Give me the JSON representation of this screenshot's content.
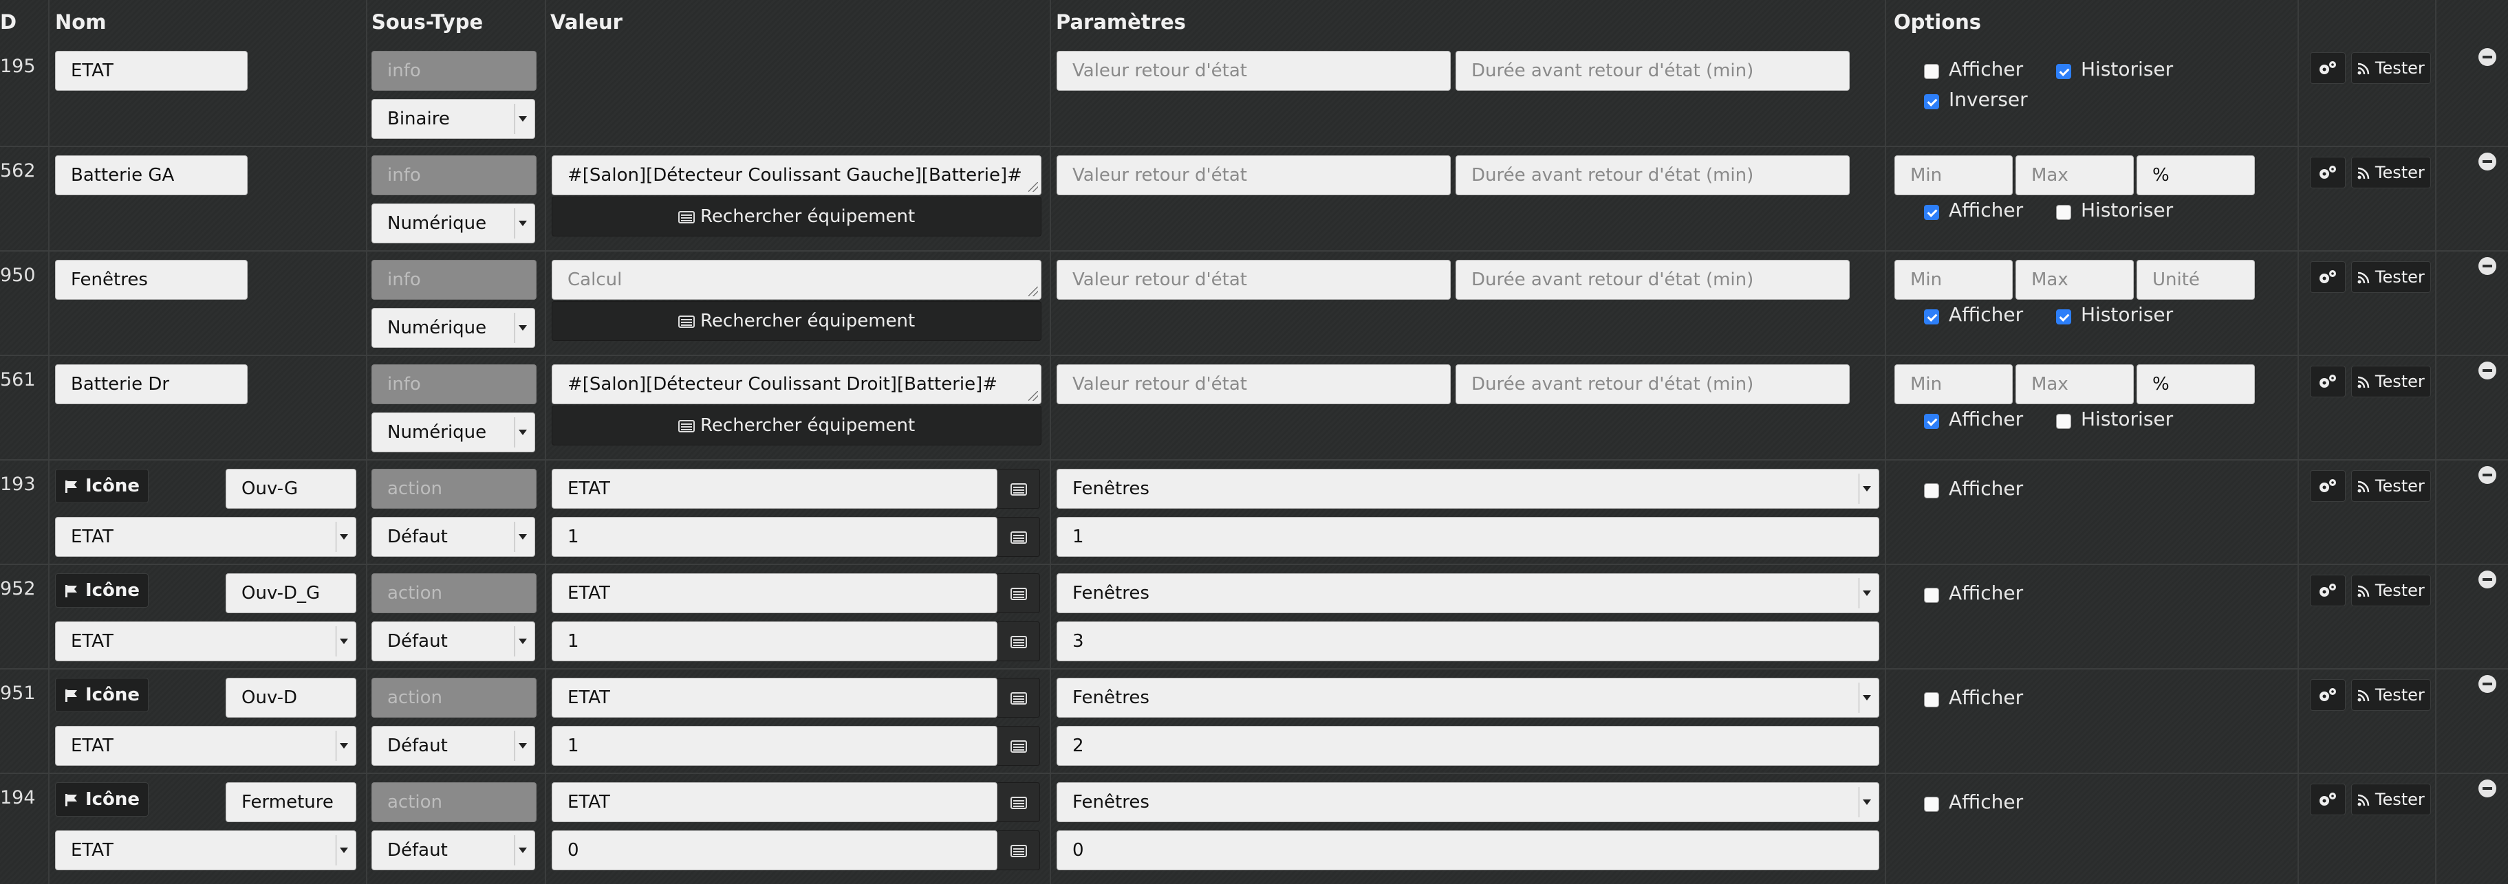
{
  "headers": {
    "id": "D",
    "nom": "Nom",
    "soustype": "Sous-Type",
    "valeur": "Valeur",
    "parametres": "Paramètres",
    "options": "Options"
  },
  "labels": {
    "rechercher": "Rechercher équipement",
    "icone": "Icône",
    "tester": "Tester",
    "afficher": "Afficher",
    "historiser": "Historiser",
    "inverser": "Inverser"
  },
  "placeholders": {
    "valeur_retour": "Valeur retour d'état",
    "duree_retour": "Durée avant retour d'état (min)",
    "min": "Min",
    "max": "Max",
    "unite": "Unité",
    "calcul": "Calcul"
  },
  "colors": {
    "checkbox_checked": "#2d7ff9",
    "background": "#2b2d2d"
  },
  "info_rows": [
    {
      "id": "195",
      "nom": "ETAT",
      "type": "info",
      "subtype": "Binaire",
      "valeur": "",
      "valeur_is_placeholder": false,
      "min": null,
      "max": null,
      "unite": null,
      "afficher": false,
      "historiser": true,
      "inverser": true
    },
    {
      "id": "562",
      "nom": "Batterie GA",
      "type": "info",
      "subtype": "Numérique",
      "valeur": "#[Salon][Détecteur Coulissant Gauche][Batterie]#",
      "min": "Min",
      "max": "Max",
      "unite": "%",
      "afficher": true,
      "historiser": false
    },
    {
      "id": "950",
      "nom": "Fenêtres",
      "type": "info",
      "subtype": "Numérique",
      "valeur": "Calcul",
      "min": "Min",
      "max": "Max",
      "unite": "Unité",
      "afficher": true,
      "historiser": true
    },
    {
      "id": "561",
      "nom": "Batterie Dr",
      "type": "info",
      "subtype": "Numérique",
      "valeur": "#[Salon][Détecteur Coulissant Droit][Batterie]#",
      "min": "Min",
      "max": "Max",
      "unite": "%",
      "afficher": true,
      "historiser": false
    }
  ],
  "action_rows": [
    {
      "id": "193",
      "nom": "Ouv-G",
      "type": "action",
      "subtype": "Défaut",
      "etat": "ETAT",
      "cmd": "ETAT",
      "cmd_val": "1",
      "param": "Fenêtres",
      "param_val": "1",
      "afficher": false
    },
    {
      "id": "952",
      "nom": "Ouv-D_G",
      "type": "action",
      "subtype": "Défaut",
      "etat": "ETAT",
      "cmd": "ETAT",
      "cmd_val": "1",
      "param": "Fenêtres",
      "param_val": "3",
      "afficher": false
    },
    {
      "id": "951",
      "nom": "Ouv-D",
      "type": "action",
      "subtype": "Défaut",
      "etat": "ETAT",
      "cmd": "ETAT",
      "cmd_val": "1",
      "param": "Fenêtres",
      "param_val": "2",
      "afficher": false
    },
    {
      "id": "194",
      "nom": "Fermeture",
      "type": "action",
      "subtype": "Défaut",
      "etat": "ETAT",
      "cmd": "ETAT",
      "cmd_val": "0",
      "param": "Fenêtres",
      "param_val": "0",
      "afficher": false
    }
  ]
}
